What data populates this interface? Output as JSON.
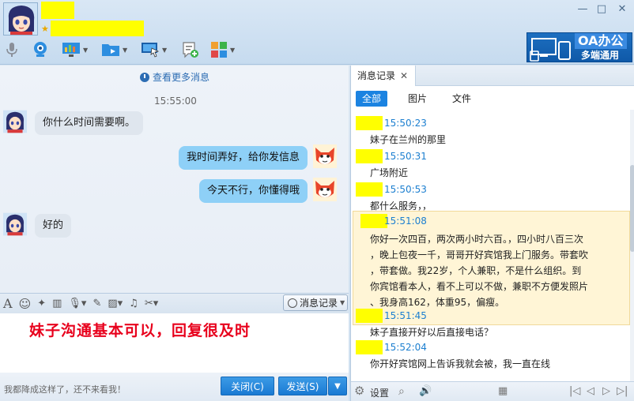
{
  "window": {
    "minimize_glyph": "—",
    "maximize_glyph": "□",
    "close_glyph": "✕"
  },
  "toolbar": {
    "icons": [
      "microphone-icon",
      "camera-icon",
      "screen-share-icon",
      "file-transfer-icon",
      "remote-assist-icon",
      "new-task-icon",
      "apps-icon"
    ]
  },
  "banner": {
    "title": "OA办公",
    "subtitle": "多端通用"
  },
  "chat": {
    "more_messages": "查看更多消息",
    "time": "15:55:00",
    "messages": [
      {
        "side": "in",
        "text": "你什么时间需要啊。"
      },
      {
        "side": "out",
        "text": "我时间弄好，给你发信息"
      },
      {
        "side": "out",
        "text": "今天不行，你懂得哦"
      },
      {
        "side": "in",
        "text": "好的"
      }
    ]
  },
  "input_toolbar": {
    "history_button": "消息记录"
  },
  "compose": {
    "annotation": "妹子沟通基本可以，回复很及时",
    "status_text": "我都降成这样了，还不来看我！",
    "close_button": "关闭(C)",
    "send_button": "发送(S)",
    "send_dropdown": "▼"
  },
  "history": {
    "tab_label": "消息记录",
    "tab_close": "✕",
    "filters": [
      "全部",
      "图片",
      "文件"
    ],
    "messages": [
      {
        "time": "15:50:23",
        "text": "妹子在兰州的那里"
      },
      {
        "time": "15:50:31",
        "text": "广场附近"
      },
      {
        "time": "15:50:53",
        "text": "都什么服务，，"
      },
      {
        "time": "15:51:08",
        "lines": [
          "你好一次四百，两次两小时六百。，四小时八百三次",
          "，晚上包夜一千，哥哥开好宾馆我上门服务。带套吹",
          "，带套做。我22岁，个人兼职，不是什么组织。到",
          "你宾馆看本人，看不上可以不做，兼职不方便发照片",
          "、我身高162，体重95，偏瘦。"
        ]
      },
      {
        "time": "15:51:45",
        "text": "妹子直接开好以后直接电话？"
      },
      {
        "time": "15:52:04",
        "text": "你开好宾馆网上告诉我就会被，我一直在线"
      }
    ],
    "footer": {
      "settings_label": "设置"
    }
  },
  "colors": {
    "accent": "#1b83e1",
    "highlight_bg": "#fff5d6",
    "annotation": "#e8001c",
    "redaction": "#ffff00"
  }
}
